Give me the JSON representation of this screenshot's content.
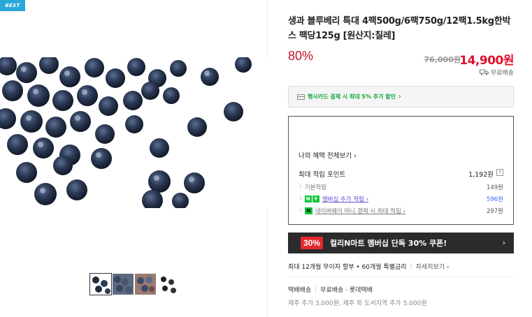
{
  "badge": "BEST",
  "product": {
    "title": "생과 블루베리 특대 4팩500g/6팩750g/12팩1.5kg한박스 팩당125g [원산지:칠레]",
    "discount": "80%",
    "original_price": "76,000원",
    "sale_price": "14,900원",
    "shipping": "무료배송"
  },
  "card_promo": {
    "text": "행사카드 결제 시 최대 5% 추가 할인",
    "chevron": "›"
  },
  "benefits": {
    "title": "나의 혜택 전체보기 ›",
    "max_points_label": "최대 적립 포인트",
    "max_points_value": "1,192원",
    "help": "?",
    "rows": [
      {
        "label": "기본적립",
        "value": "149원"
      },
      {
        "label": "멤버십 추가 적립 ›",
        "value": "596원"
      },
      {
        "label": "네이버페이 머니 결제 시 최대 적립 ›",
        "value": "297원"
      }
    ]
  },
  "coupon": {
    "percent": "30%",
    "text": "컬리N마트 멤버십 단독 30% 쿠폰!",
    "chevron": "›"
  },
  "installment": {
    "text": "최대 12개월 무이자 할부 • 60개월 특별금리",
    "detail": "자세히보기 ›"
  },
  "delivery": {
    "method": "택배배송",
    "fee": "무료배송 · 롯데택배",
    "extra": "제주 추가 3,000원, 제주 외 도서지역 추가 5,000원"
  },
  "icons": {
    "truck": "truck-icon",
    "card": "credit-card-icon",
    "membership_n": "N",
    "membership_plus": "+",
    "npay": "N"
  },
  "colors": {
    "discount": "#c8102e",
    "price": "#e0112b",
    "promo_green": "#13a83a",
    "coupon_red": "#e6262f",
    "badge_blue": "#2aa8d9"
  }
}
